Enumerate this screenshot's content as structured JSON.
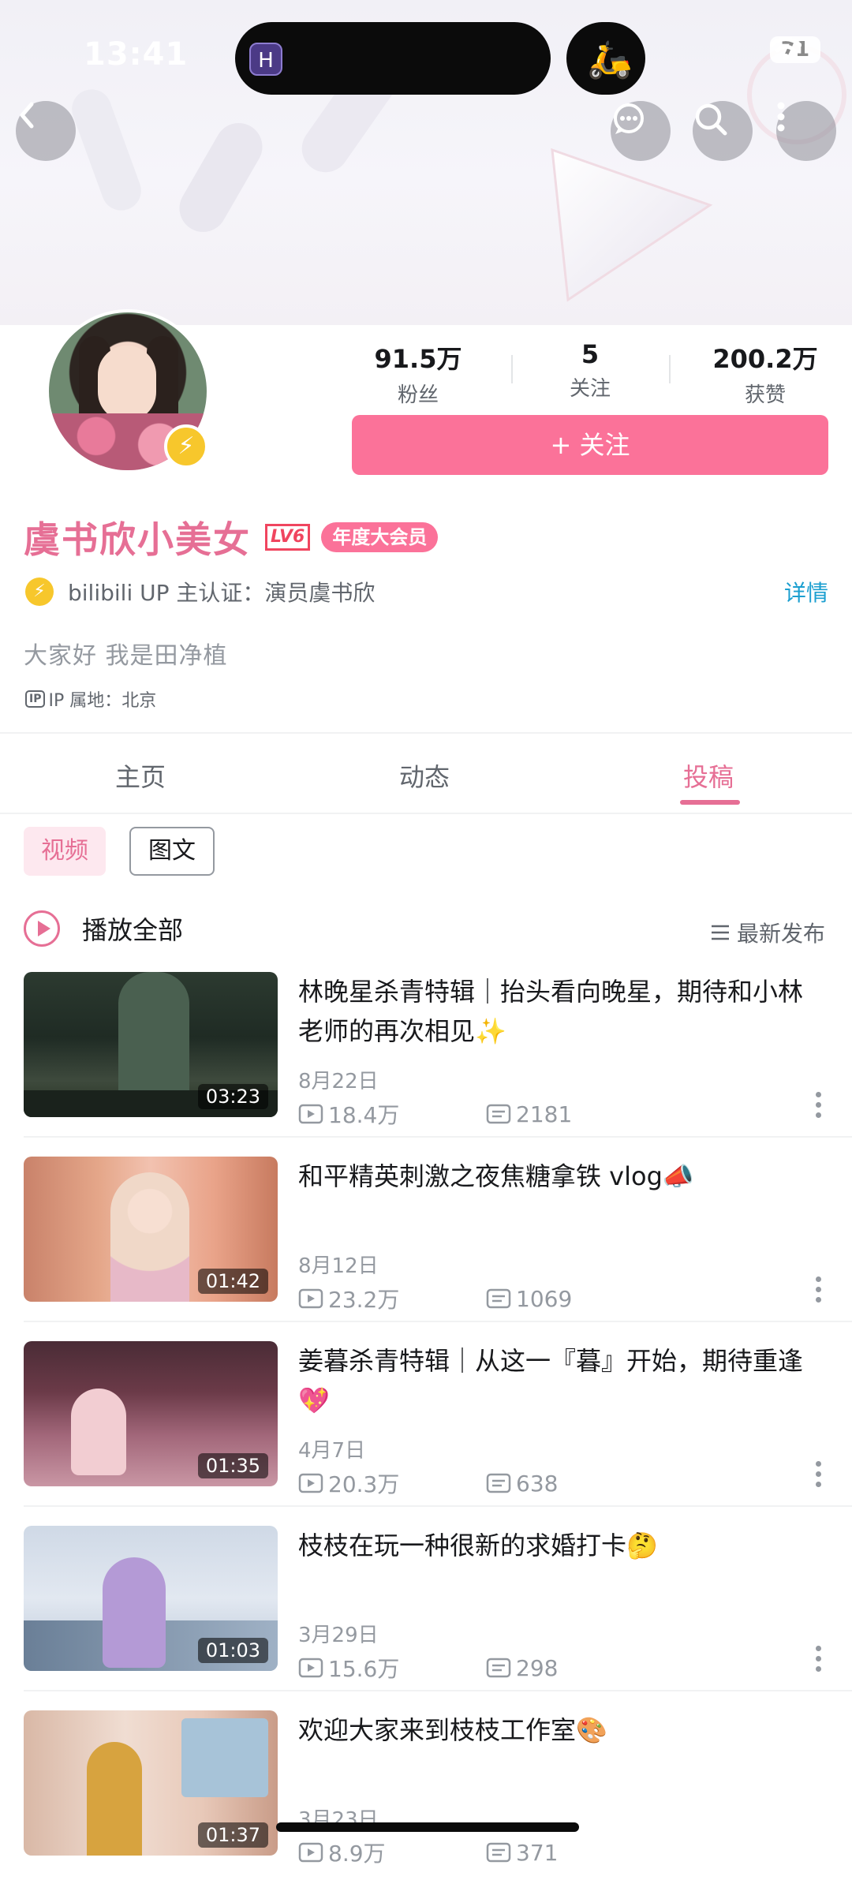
{
  "status_bar": {
    "time": "13:41",
    "battery": "71",
    "island_app": "H"
  },
  "profile": {
    "name": "虞书欣小美女",
    "level": "LV6",
    "vip_badge": "年度大会员",
    "verify_text": "bilibili UP 主认证：演员虞书欣",
    "detail_link": "详情",
    "bio": "大家好 我是田净植",
    "ip_icon": "IP",
    "ip_location": "IP 属地：北京",
    "follow_button": "+ 关注",
    "stats": [
      {
        "value": "91.5万",
        "label": "粉丝"
      },
      {
        "value": "5",
        "label": "关注"
      },
      {
        "value": "200.2万",
        "label": "获赞"
      }
    ]
  },
  "tabs": [
    {
      "label": "主页",
      "active": false
    },
    {
      "label": "动态",
      "active": false
    },
    {
      "label": "投稿",
      "active": true
    }
  ],
  "filters": [
    {
      "label": "视频",
      "active": true
    },
    {
      "label": "图文",
      "active": false
    }
  ],
  "play_all": "播放全部",
  "sort_label": "最新发布",
  "videos": [
    {
      "title": "林晚星杀青特辑｜抬头看向晚星，期待和小林老师的再次相见✨",
      "date": "8月22日",
      "views": "18.4万",
      "danmaku": "2181",
      "duration": "03:23"
    },
    {
      "title": "和平精英刺激之夜焦糖拿铁 vlog📣",
      "date": "8月12日",
      "views": "23.2万",
      "danmaku": "1069",
      "duration": "01:42"
    },
    {
      "title": "姜暮杀青特辑｜从这一『暮』开始，期待重逢💖",
      "date": "4月7日",
      "views": "20.3万",
      "danmaku": "638",
      "duration": "01:35"
    },
    {
      "title": "枝枝在玩一种很新的求婚打卡🤔",
      "date": "3月29日",
      "views": "15.6万",
      "danmaku": "298",
      "duration": "01:03"
    },
    {
      "title": "欢迎大家来到枝枝工作室🎨",
      "date": "3月23日",
      "views": "8.9万",
      "danmaku": "371",
      "duration": "01:37"
    }
  ],
  "colors": {
    "accent": "#fb7299",
    "name_pink": "#e66f95",
    "link_blue": "#1b9fd0"
  },
  "icons": [
    "back-arrow-icon",
    "message-icon",
    "search-icon",
    "more-icon",
    "wifi-icon",
    "lightning-icon",
    "play-icon",
    "sort-icon",
    "views-icon",
    "danmaku-icon"
  ]
}
